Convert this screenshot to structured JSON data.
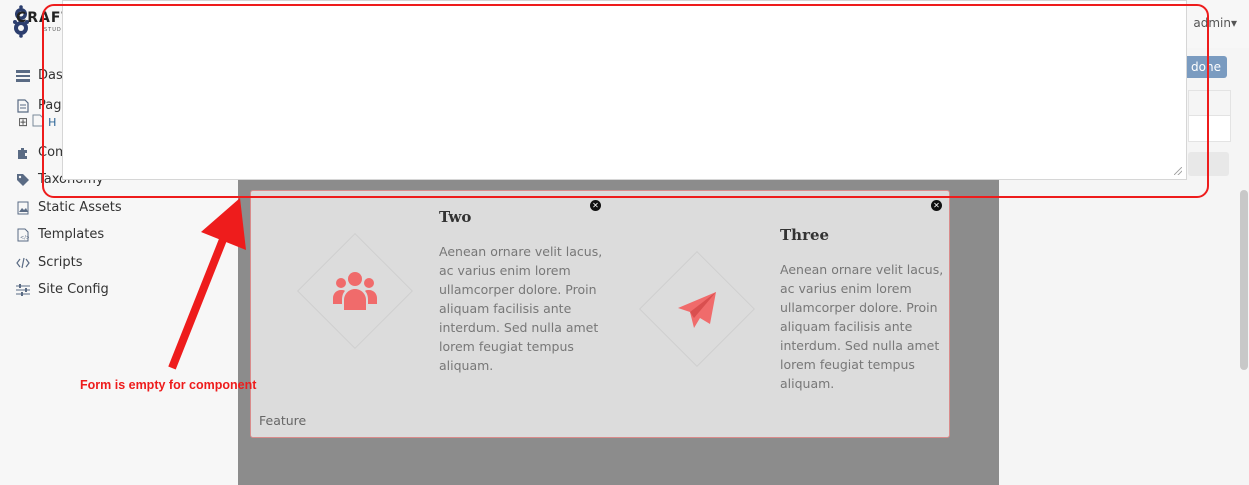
{
  "brand": {
    "name": "CRAFT",
    "sub": "STUDIO"
  },
  "header": {
    "user": "admin",
    "user_caret": "▾"
  },
  "sidebar": {
    "items": [
      {
        "label": "Dash",
        "icon": "dashboard-icon"
      },
      {
        "label": "Page",
        "icon": "page-icon"
      },
      {
        "label": "Com",
        "icon": "puzzle-icon"
      },
      {
        "label": "Taxonomy",
        "icon": "tag-icon"
      },
      {
        "label": "Static Assets",
        "icon": "image-icon"
      },
      {
        "label": "Templates",
        "icon": "template-icon"
      },
      {
        "label": "Scripts",
        "icon": "code-icon"
      },
      {
        "label": "Site Config",
        "icon": "sliders-icon"
      }
    ],
    "subtree": {
      "expand": "⊞",
      "label": "H"
    }
  },
  "toolbar": {
    "done_label": "done"
  },
  "feature": {
    "items": [
      {
        "title": "Two",
        "text": "Aenean ornare velit lacus, ac varius enim lorem ullamcorper dolore. Proin aliquam facilisis ante interdum. Sed nulla amet lorem feugiat tempus aliquam.",
        "icon": "users-icon"
      },
      {
        "title": "Three",
        "text": "Aenean ornare velit lacus, ac varius enim lorem ullamcorper dolore. Proin aliquam facilisis ante interdum. Sed nulla amet lorem feugiat tempus aliquam.",
        "icon": "paper-plane-icon"
      }
    ],
    "label": "Feature",
    "accent": "#f06b6b"
  },
  "annotation": {
    "text": "Form is empty for component",
    "color": "#ee1c1c"
  }
}
